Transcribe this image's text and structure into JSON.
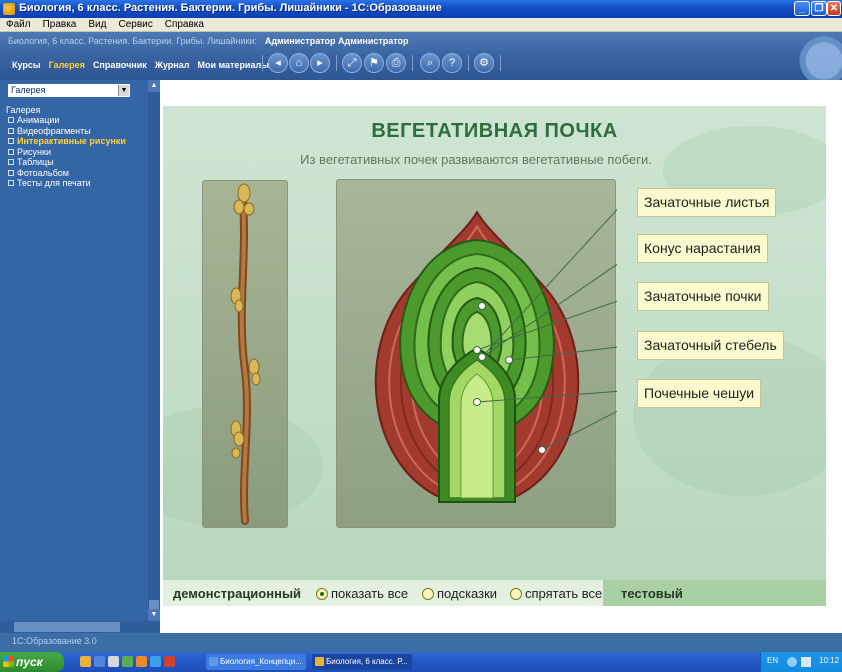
{
  "window": {
    "title": "Биология, 6 класс. Растения. Бактерии. Грибы. Лишайники - 1С:Образование"
  },
  "menu": [
    "Файл",
    "Правка",
    "Вид",
    "Сервис",
    "Справка"
  ],
  "header": {
    "breadcrumb": "Биология, 6 класс. Растения. Бактерии. Грибы. Лишайники:",
    "user": "Администратор Администратор",
    "tabs": [
      "Курсы",
      "Галерея",
      "Справочник",
      "Журнал",
      "Мои материалы"
    ],
    "active_tab": "Галерея",
    "toolbar_icons": [
      "arrow-left-icon",
      "home-icon",
      "arrow-right-icon",
      "fullscreen-icon",
      "bookmark-icon",
      "print-icon",
      "search-icon",
      "help-icon",
      "tools-icon"
    ]
  },
  "sidebar": {
    "select_value": "Галерея",
    "heading": "Галерея",
    "items": [
      "Анимации",
      "Видеофрагменты",
      "Интерактивные рисунки",
      "Рисунки",
      "Таблицы",
      "Фотоальбом",
      "Тесты для печати"
    ],
    "active_item": "Интерактивные рисунки"
  },
  "content": {
    "title": "ВЕГЕТАТИВНАЯ ПОЧКА",
    "subtitle": "Из вегетативных почек развиваются вегетативные побеги.",
    "labels": [
      "Зачаточные листья",
      "Конус нарастания",
      "Зачаточные почки",
      "Зачаточный стебель",
      "Почечные чешуи"
    ],
    "modes": {
      "demo_label": "демонстрационный",
      "options": [
        "показать все",
        "подсказки",
        "спрятать все"
      ],
      "selected": "показать все",
      "test_label": "тестовый"
    }
  },
  "status": "1С:Образование 3.0",
  "taskbar": {
    "start": "пуск",
    "tasks": [
      "Биология_Концепци...",
      "Биология, 6 класс. Р..."
    ],
    "tray_lang": "EN",
    "clock": "10:12"
  },
  "colors": {
    "accent": "#ffd23a",
    "title_green": "#2d6e3e",
    "callout_bg": "#fbfbcf",
    "scale_red": "#a33a2e",
    "leaf_green": "#7dc04a"
  }
}
